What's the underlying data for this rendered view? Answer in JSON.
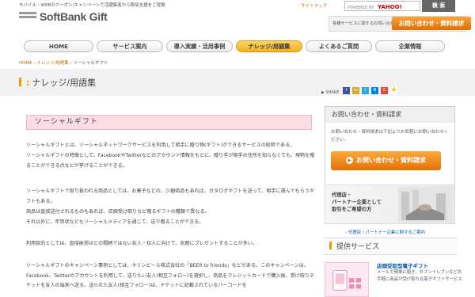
{
  "header": {
    "tagline": "モバイル・WEBのクーポン/キャンペーンで活躍集客から販促支援をご提案",
    "logo_text": "SoftBank Gift",
    "sitemap_label": "サイトマップ",
    "search_powered": "POWERED BY",
    "search_brand": "YAHOO!",
    "search_button": "検 索",
    "contact_note": "各種サービスに関するお問い合わせはこちら",
    "contact_button": "お問い合わせ・資料請求"
  },
  "nav": {
    "items": [
      "HOME",
      "サービス案内",
      "導入実績・活用事例",
      "ナレッジ/用語集",
      "よくあるご質問",
      "企業情報"
    ],
    "active_index": 3
  },
  "breadcrumb": {
    "home": "HOME",
    "separator": "›",
    "parent": "ナレッジ/用語集",
    "current": "ソーシャルギフト"
  },
  "page": {
    "title": "ナレッジ/用語集",
    "share_label": "SHARE"
  },
  "article": {
    "heading": "ソーシャルギフト",
    "p1": "ソーシャルギフトとは、ソーシャルネットワークサービスを利用して相手に贈り物(ギフト)ができるサービスの総称である。",
    "p1b": "ソーシャルギフトの特徴として、FacebookやTwitterなどのアカウント情報をもとに、贈り手が相手の住所を知らなくても、現物を贈ることができる点などが挙げることができる。",
    "p2": "ソーシャルギフトで取り扱われる商品としては、お菓子などの、少額商品もあれば、カタログギフトを送って、相手に選んでもらうギフトもある。",
    "p2b": "商品は直接送付されるものもあれば、店頭受け取りなど贈るギフトの種類で異なる。",
    "p2c": "それ以外に、年賀状などもソーシャルメディアを通じて、送り贈ることができる。",
    "p3": "利用目的としては、直接挨拶ほどの間柄ではない友人・知人に向けて、気軽にプレゼントすることが多い。",
    "p4": "ソーシャルギフトのキャンペーン事例としては、キリンビール株式会社の「BEER to friends」などがある。このキャンペーンは、Facebook、Twitterのアカウントを利用して、送りたい友人(相互フォロー)を選択し、商品をクレジットカードで購入後、受け取りチケットを友人の端末へ送る。送られた友人(相互フォロー)は、チケットに記載されているバーコードを"
  },
  "sidebar": {
    "contact_title": "お問い合わせ・資料請求",
    "contact_text": "お問い合わせ・資料請求は下記よりお気軽にお問い合わせください。",
    "contact_button": "お問い合わせ・資料請求",
    "partner_line1": "代理店・",
    "partner_line2": "パートナー企業として",
    "partner_line3": "取引をご希望の方",
    "partner_link": "代理店・パートナー企業に関するご案内",
    "services_title": "提供サービス",
    "service_name": "店頭受取型電子ギフト",
    "service_desc": "メールで簡単に届き、セブンイレブンなどお手軽に商品が受け取れる電子ギフトサービス"
  },
  "colors": {
    "accent": "#f39800",
    "nav_active": "#f3b21e",
    "article_heading_bg": "#fcdde6",
    "link": "#0b5aa8"
  },
  "icons": {
    "share": [
      "facebook-icon",
      "mixi-icon",
      "twitter-icon",
      "hatena-icon",
      "google-plus-icon",
      "star-icon"
    ]
  }
}
